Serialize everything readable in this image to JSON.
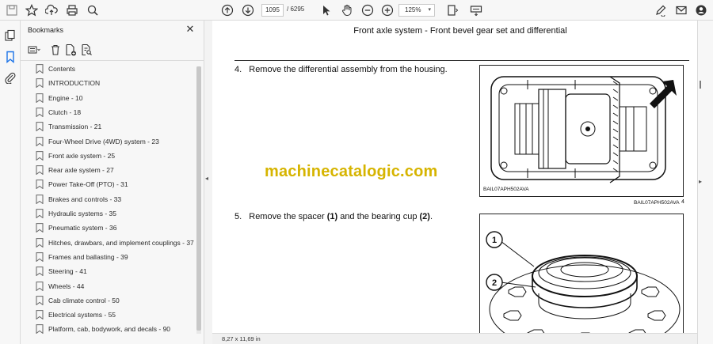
{
  "toolbar": {
    "page_current": "1095",
    "page_total": "/ 6295",
    "zoom": "125%"
  },
  "bookmarks": {
    "title": "Bookmarks",
    "close_glyph": "✕",
    "items": [
      {
        "label": "Contents"
      },
      {
        "label": "INTRODUCTION"
      },
      {
        "label": "Engine - 10"
      },
      {
        "label": "Clutch - 18"
      },
      {
        "label": "Transmission - 21"
      },
      {
        "label": "Four-Wheel Drive (4WD) system - 23"
      },
      {
        "label": "Front axle system - 25"
      },
      {
        "label": "Rear axle system - 27"
      },
      {
        "label": "Power Take-Off (PTO) - 31"
      },
      {
        "label": "Brakes and controls - 33"
      },
      {
        "label": "Hydraulic systems - 35"
      },
      {
        "label": "Pneumatic system - 36"
      },
      {
        "label": "Hitches, drawbars, and implement couplings - 37"
      },
      {
        "label": "Frames and ballasting - 39"
      },
      {
        "label": "Steering - 41"
      },
      {
        "label": "Wheels - 44"
      },
      {
        "label": "Cab climate control - 50"
      },
      {
        "label": "Electrical systems - 55"
      },
      {
        "label": "Platform, cab, bodywork, and decals - 90"
      }
    ]
  },
  "document": {
    "header": "Front axle system - Front bevel gear set and differential",
    "step4": {
      "num": "4.",
      "text": "Remove the differential assembly from the housing."
    },
    "step5": {
      "num": "5.",
      "pre": "Remove the spacer ",
      "b1": "(1)",
      "mid": " and the bearing cup ",
      "b2": "(2)",
      "post": "."
    },
    "watermark": "machinecatalogic.com",
    "fig1_caption_inner": "BAIL07APH502AVA",
    "fig1_caption_outer": "BAIL07APH502AVA",
    "fig1_number": "4",
    "callout1": "1",
    "callout2": "2"
  },
  "status": {
    "page_size": "8,27 x 11,69 in"
  },
  "colors": {
    "watermark": "#d6b400",
    "bookmark_icon": "#666666"
  }
}
